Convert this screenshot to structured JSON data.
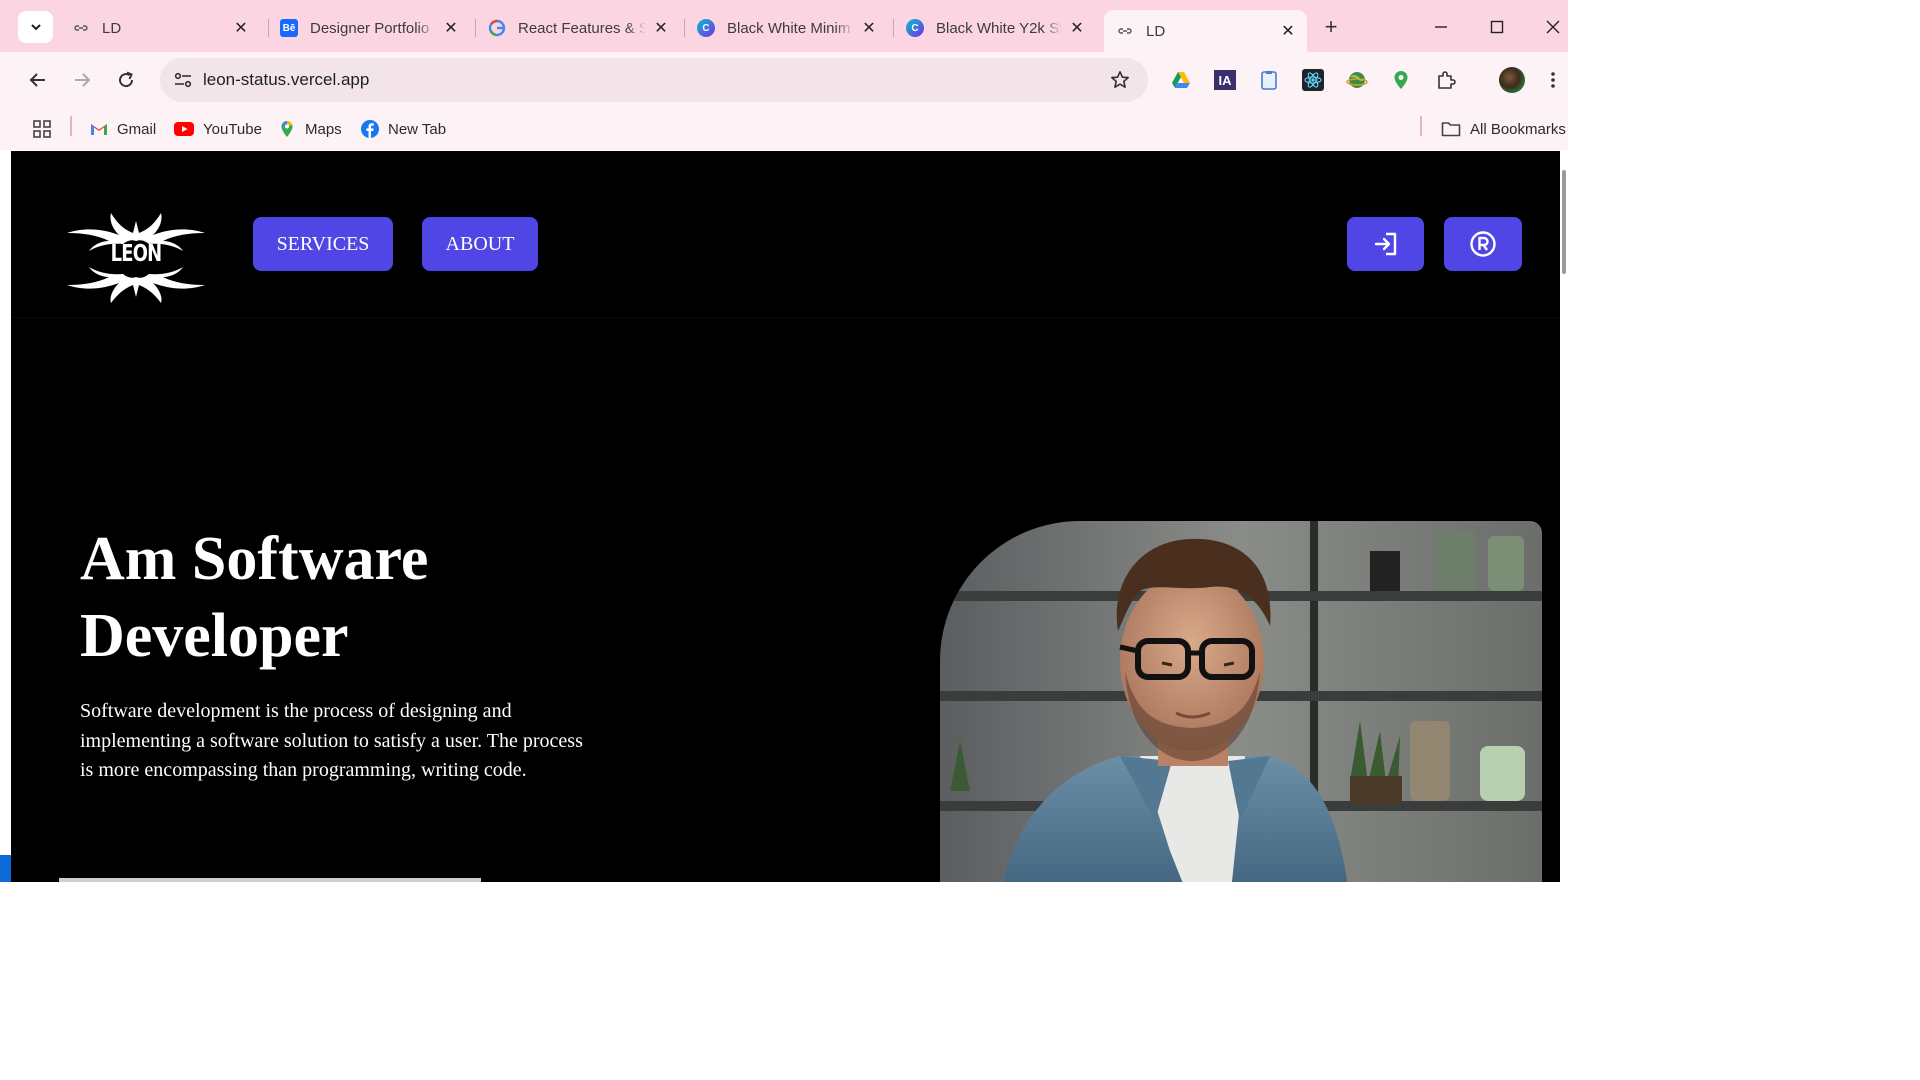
{
  "browser": {
    "tabs": [
      {
        "title": "LD",
        "favicon": "link-icon",
        "active": false
      },
      {
        "title": "Designer Portfolio",
        "favicon": "behance-icon",
        "active": false
      },
      {
        "title": "React Features & S",
        "favicon": "google-icon",
        "active": false
      },
      {
        "title": "Black White Minim",
        "favicon": "canva-icon",
        "active": false
      },
      {
        "title": "Black White Y2k St",
        "favicon": "canva-icon",
        "active": false
      },
      {
        "title": "LD",
        "favicon": "link-icon",
        "active": true
      }
    ],
    "url": "leon-status.vercel.app",
    "extensions": [
      "google-drive-icon",
      "ia-icon",
      "clipboard-icon",
      "react-devtools-icon",
      "globe-icon",
      "maps-pin-icon",
      "puzzle-icon",
      "profile-avatar"
    ],
    "bookmarks": [
      {
        "label": "Gmail",
        "icon": "gmail-icon"
      },
      {
        "label": "YouTube",
        "icon": "youtube-icon"
      },
      {
        "label": "Maps",
        "icon": "maps-icon"
      },
      {
        "label": "New Tab",
        "icon": "facebook-icon"
      }
    ],
    "all_bookmarks_label": "All Bookmarks"
  },
  "site": {
    "logo_text": "LEON",
    "nav": {
      "services_label": "SERVICES",
      "about_label": "ABOUT",
      "login_icon": "login-icon",
      "register_icon": "registered-icon"
    },
    "hero": {
      "title": "Am Software Developer",
      "description": "Software development is the process of designing and implementing a software solution to satisfy a user. The process is more encompassing than programming, writing code."
    }
  },
  "colors": {
    "accent": "#4f46e5",
    "page_background": "#000000",
    "tabstrip": "#fbd6e2",
    "toolbar": "#fdf2f5"
  }
}
